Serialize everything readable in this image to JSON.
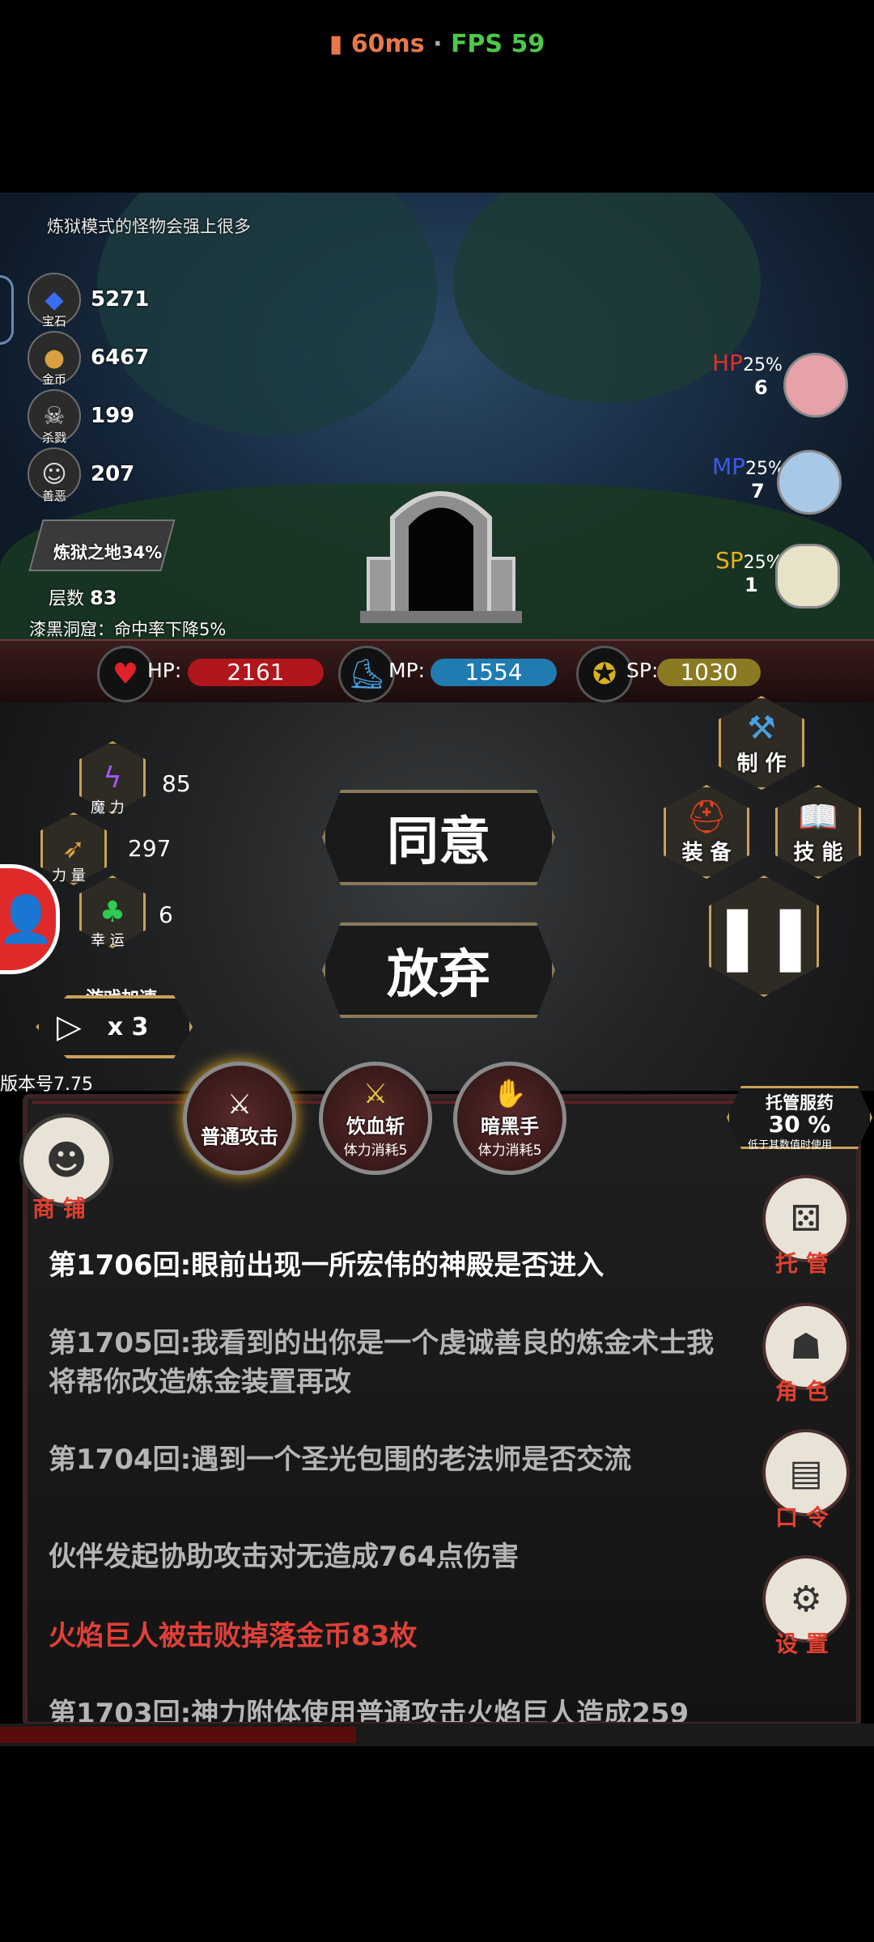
{
  "status": {
    "ping": "60ms",
    "separator": "·",
    "fps": "FPS 59"
  },
  "scene": {
    "hint": "炼狱模式的怪物会强上很多",
    "resources": [
      {
        "icon": "gem-icon",
        "label": "宝石",
        "value": "5271"
      },
      {
        "icon": "coin-icon",
        "label": "金币",
        "value": "6467"
      },
      {
        "icon": "skull-icon",
        "label": "杀戮",
        "value": "199"
      },
      {
        "icon": "mask-icon",
        "label": "善恶",
        "value": "207"
      }
    ],
    "location": {
      "name": "炼狱之地34%",
      "floor_label": "层数",
      "floor": "83"
    },
    "debuff": "漆黑洞窟：命中率下降5%",
    "potions": [
      {
        "label": "HP",
        "pct": "25%",
        "count": "6",
        "color": "#e0302a"
      },
      {
        "label": "MP",
        "pct": "25%",
        "count": "7",
        "color": "#3a5ae8"
      },
      {
        "label": "SP",
        "pct": "25%",
        "count": "1",
        "color": "#e8b020"
      }
    ]
  },
  "stats": {
    "hp": {
      "label": "HP:",
      "value": "2161",
      "color": "#b0161c"
    },
    "mp": {
      "label": "MP:",
      "value": "1554",
      "color": "#1f7bb0"
    },
    "sp": {
      "label": "SP:",
      "value": "1030",
      "color": "#8a7a22"
    }
  },
  "attributes": [
    {
      "icon": "lightning-icon",
      "label": "魔 力",
      "value": "85"
    },
    {
      "icon": "bow-icon",
      "label": "力 量",
      "value": "297"
    },
    {
      "icon": "clover-icon",
      "label": "幸 运",
      "value": "6"
    }
  ],
  "speed": {
    "label": "游戏加速",
    "multiplier": "x 3"
  },
  "version": "版本号7.75",
  "choices": {
    "agree": "同意",
    "abandon": "放弃"
  },
  "menu": {
    "craft": "制 作",
    "equip": "装 备",
    "skill": "技 能"
  },
  "skills": [
    {
      "name": "普通攻击",
      "cost": ""
    },
    {
      "name": "饮血斩",
      "cost": "体力消耗5"
    },
    {
      "name": "暗黑手",
      "cost": "体力消耗5"
    }
  ],
  "auto_potion": {
    "title": "托管服药",
    "pct": "30 %",
    "note": "低于其数值时使用"
  },
  "shop": "商 铺",
  "side_buttons": [
    {
      "icon": "dice-icon",
      "label": "托 管"
    },
    {
      "icon": "hooded-figure-icon",
      "label": "角 色"
    },
    {
      "icon": "scroll-icon",
      "label": "口 令"
    },
    {
      "icon": "gear-icon",
      "label": "设 置"
    }
  ],
  "logs": [
    {
      "text": "第1706回:眼前出现一所宏伟的神殿是否进入",
      "kind": "cur"
    },
    {
      "text": "第1705回:我看到的出你是一个虔诚善良的炼金术士我将帮你改造炼金装置再改",
      "kind": "old"
    },
    {
      "text": "第1704回:遇到一个圣光包围的老法师是否交流",
      "kind": "old"
    },
    {
      "text": "伙伴发起协助攻击对无造成764点伤害",
      "kind": "old"
    },
    {
      "text": "火焰巨人被击败掉落金币83枚",
      "kind": "red"
    },
    {
      "text": "第1703回:神力附体使用普通攻击火焰巨人造成259",
      "kind": "old"
    }
  ]
}
